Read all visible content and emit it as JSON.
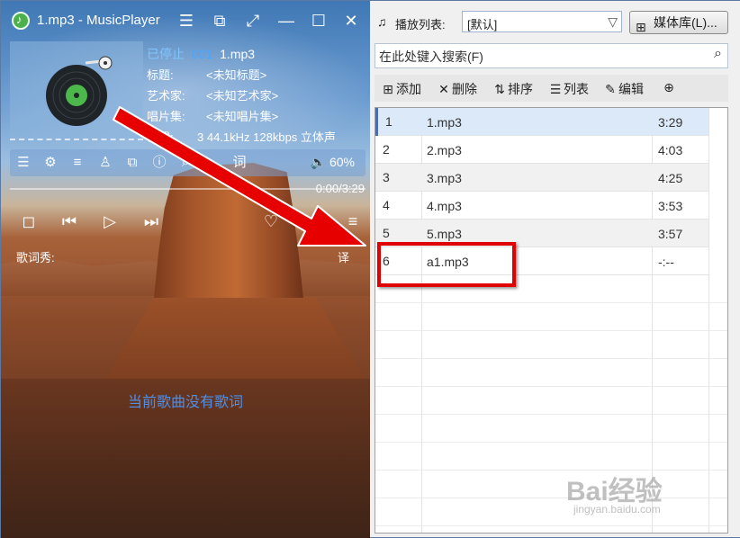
{
  "window": {
    "title": "1.mp3 - MusicPlayer"
  },
  "player": {
    "status": "已停止",
    "track_number": "001",
    "track_file": "1.mp3",
    "info": [
      {
        "label": "标题:",
        "value": "<未知标题>"
      },
      {
        "label": "艺术家:",
        "value": "<未知艺术家>"
      },
      {
        "label": "唱片集:",
        "value": "<未知唱片集>"
      },
      {
        "label": "格式:",
        "value": "3 44.1kHz 128kbps 立体声"
      }
    ],
    "volume": "60%",
    "time": "0:00/3:29",
    "progress": 0,
    "lyric_label": "歌词秀:",
    "lyric_translate": "译",
    "lyric_tool": "词",
    "no_lyrics": "当前歌曲没有歌词"
  },
  "playlist": {
    "label": "播放列表:",
    "selected": "[默认]",
    "media_button": "媒体库(L)...",
    "search_placeholder": "在此处键入搜索(F)",
    "actions": [
      {
        "icon": "add-icon",
        "label": "添加"
      },
      {
        "icon": "delete-icon",
        "label": "删除"
      },
      {
        "icon": "sort-icon",
        "label": "排序"
      },
      {
        "icon": "list-icon",
        "label": "列表"
      },
      {
        "icon": "edit-icon",
        "label": "编辑"
      }
    ],
    "rows": [
      {
        "index": "1",
        "name": "1.mp3",
        "duration": "3:29"
      },
      {
        "index": "2",
        "name": "2.mp3",
        "duration": "4:03"
      },
      {
        "index": "3",
        "name": "3.mp3",
        "duration": "4:25"
      },
      {
        "index": "4",
        "name": "4.mp3",
        "duration": "3:53"
      },
      {
        "index": "5",
        "name": "5.mp3",
        "duration": "3:57"
      },
      {
        "index": "6",
        "name": "a1.mp3",
        "duration": "-:--"
      }
    ]
  },
  "watermark": {
    "brand": "Bai经验",
    "url": "jingyan.baidu.com"
  },
  "colors": {
    "accent": "#3b6fcf",
    "highlight_box": "#e00000",
    "no_lyrics_text": "#4f8fe8"
  }
}
